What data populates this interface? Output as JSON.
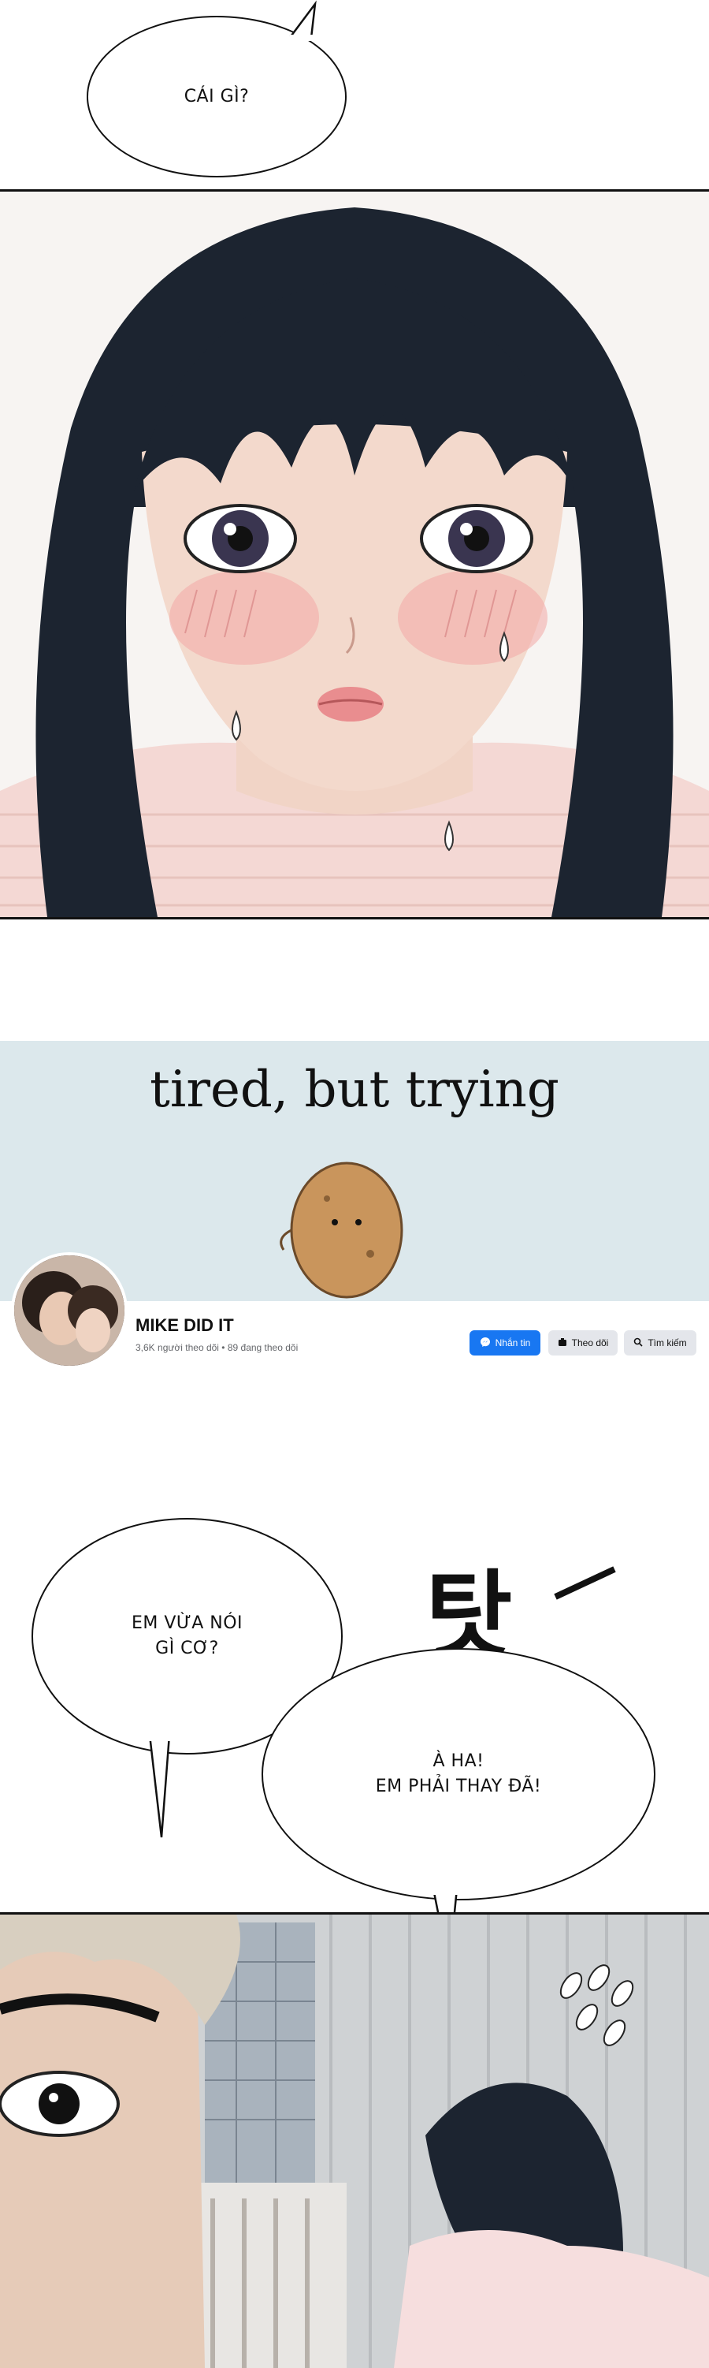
{
  "bubbles": {
    "top": "CÁI GÌ?",
    "left": "EM VỪA NÓI\nGÌ CƠ?",
    "right": "À HA!\nEM PHẢI THAY ĐÃ!"
  },
  "sfx": "탓",
  "banner": {
    "title": "tired, but trying",
    "page_name": "MIKE DID IT",
    "stats": "3,6K người theo dõi • 89 đang theo dõi",
    "buttons": {
      "message": "Nhắn tin",
      "follow": "Theo dõi",
      "search": "Tìm kiếm"
    }
  },
  "colors": {
    "fb_blue": "#1877f2",
    "banner_bg": "#dce8ec",
    "skin": "#f3d9cc",
    "hair": "#1c2430",
    "sweater": "#f4d8d4"
  },
  "icons": [
    "messenger-icon",
    "follow-icon",
    "search-icon"
  ]
}
